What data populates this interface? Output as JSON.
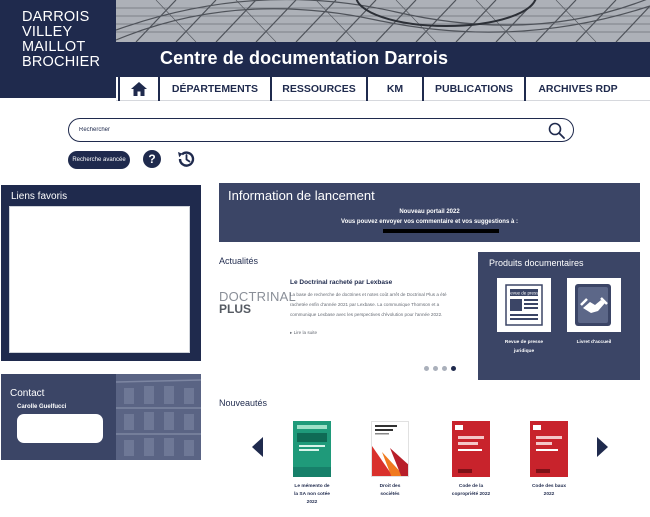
{
  "header": {
    "logo_lines": [
      "DARROIS",
      "VILLEY",
      "MAILLOT",
      "BROCHIER"
    ],
    "site_title": "Centre de documentation Darrois",
    "nav": [
      {
        "label": ""
      },
      {
        "label": "DÉPARTEMENTS"
      },
      {
        "label": "RESSOURCES"
      },
      {
        "label": "KM"
      },
      {
        "label": "PUBLICATIONS"
      },
      {
        "label": "ARCHIVES RDP"
      }
    ]
  },
  "search": {
    "placeholder": "Rechercher",
    "advanced_label": "Recherche avancée",
    "help_label": "?"
  },
  "favorites": {
    "title": "Liens favoris"
  },
  "contact": {
    "title": "Contact",
    "name": "Carolle Guelfucci"
  },
  "launch": {
    "title": "Information de lancement",
    "line1": "Nouveau portail 2022",
    "line2": "Vous pouvez envoyer vos  commentaire et vos suggestions à :"
  },
  "news": {
    "title": "Actualités",
    "logo_line1": "DOCTRINAL",
    "logo_line2": "PLUS",
    "headline": "Le Doctrinal racheté par Lexbase",
    "body": "La base de recherche de doctrines et notes coût arrêt de Doctrinal Plus a été rachetée enfin d'année 2021 par Lexbase. La communique Thomson et a communique Lexbase avec les perspectives d'évolution pour l'année 2022.",
    "more": "▸ Lire la suite",
    "slides": 4,
    "active_slide": 4
  },
  "products": {
    "title": "Produits documentaires",
    "items": [
      {
        "label_line1": "Revue de presse",
        "label_line2": "juridique",
        "tile_text": "Revue de presse"
      },
      {
        "label_line1": "Livret d'accueil",
        "label_line2": ""
      }
    ]
  },
  "new_items": {
    "title": "Nouveautés",
    "books": [
      {
        "line1": "Le mémento de",
        "line2": "la SA non cotée",
        "line3": "2022",
        "color": "#1f9a7a"
      },
      {
        "line1": "Droit des",
        "line2": "sociétés",
        "line3": "",
        "color": "#d9312c"
      },
      {
        "line1": "Code de la",
        "line2": "copropriété 2022",
        "line3": "",
        "color": "#c8232c"
      },
      {
        "line1": "Code des baux",
        "line2": "2022",
        "line3": "",
        "color": "#c8232c"
      }
    ]
  },
  "colors": {
    "navy": "#1f2a4d",
    "panel": "#3b4566",
    "dalloz_red": "#c8232c",
    "memento_green": "#1f9a7a"
  }
}
